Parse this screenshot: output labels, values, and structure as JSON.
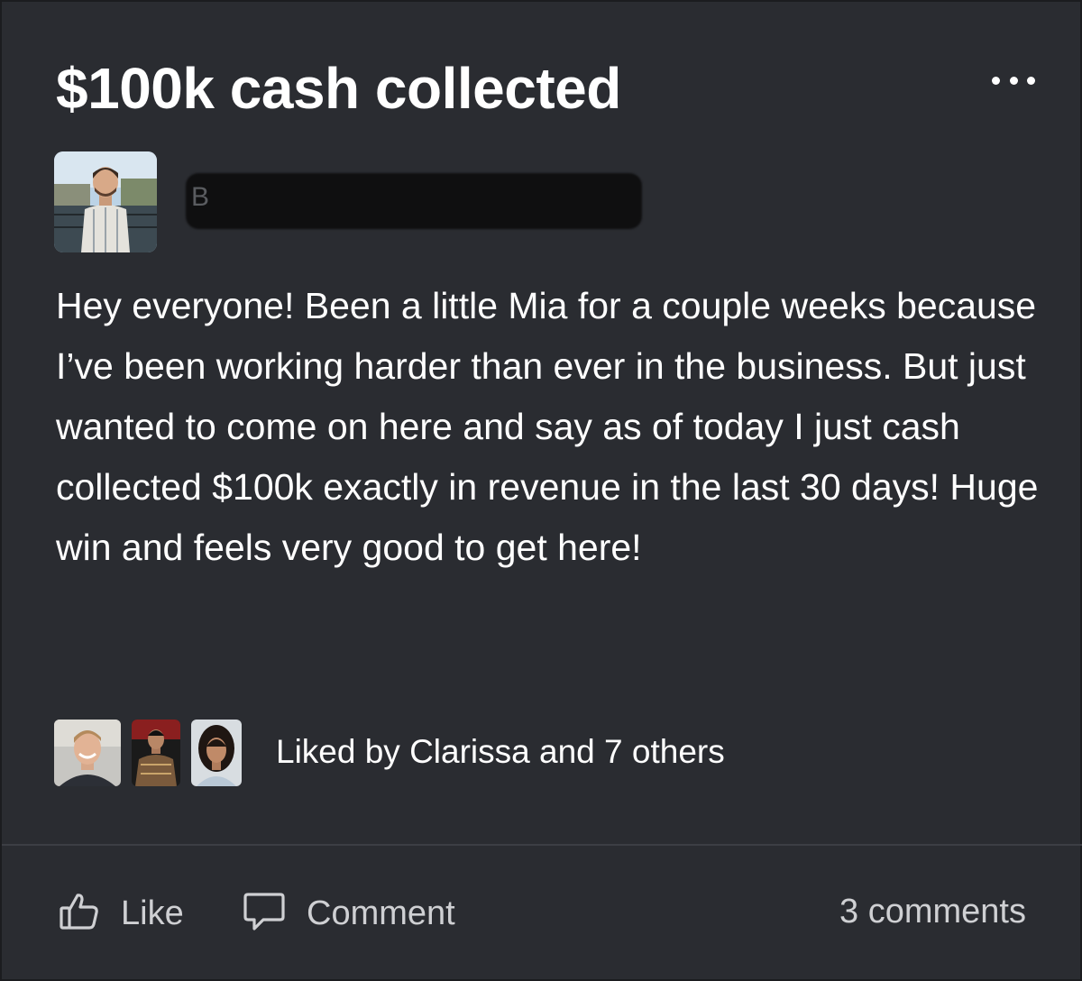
{
  "post": {
    "title": "$100k cash collected",
    "author_initial": "B",
    "body": "Hey everyone! Been a little Mia for a couple weeks because I’ve been working harder than ever in the business. But just wanted to come on here and say as of today I just cash collected $100k exactly in revenue in the last 30 days! Huge win and feels very good to get here!",
    "liked_by": "Liked by Clarissa and 7 others"
  },
  "menu": {
    "icon": "more-horizontal-icon"
  },
  "actions": {
    "like_label": "Like",
    "like_icon": "thumbs-up-icon",
    "comment_label": "Comment",
    "comment_icon": "comment-bubble-icon",
    "comments_count": "3 comments"
  },
  "colors": {
    "background": "#2a2c31",
    "text": "#ffffff",
    "muted_text": "#cfd0d3",
    "divider": "#3c3e44"
  }
}
